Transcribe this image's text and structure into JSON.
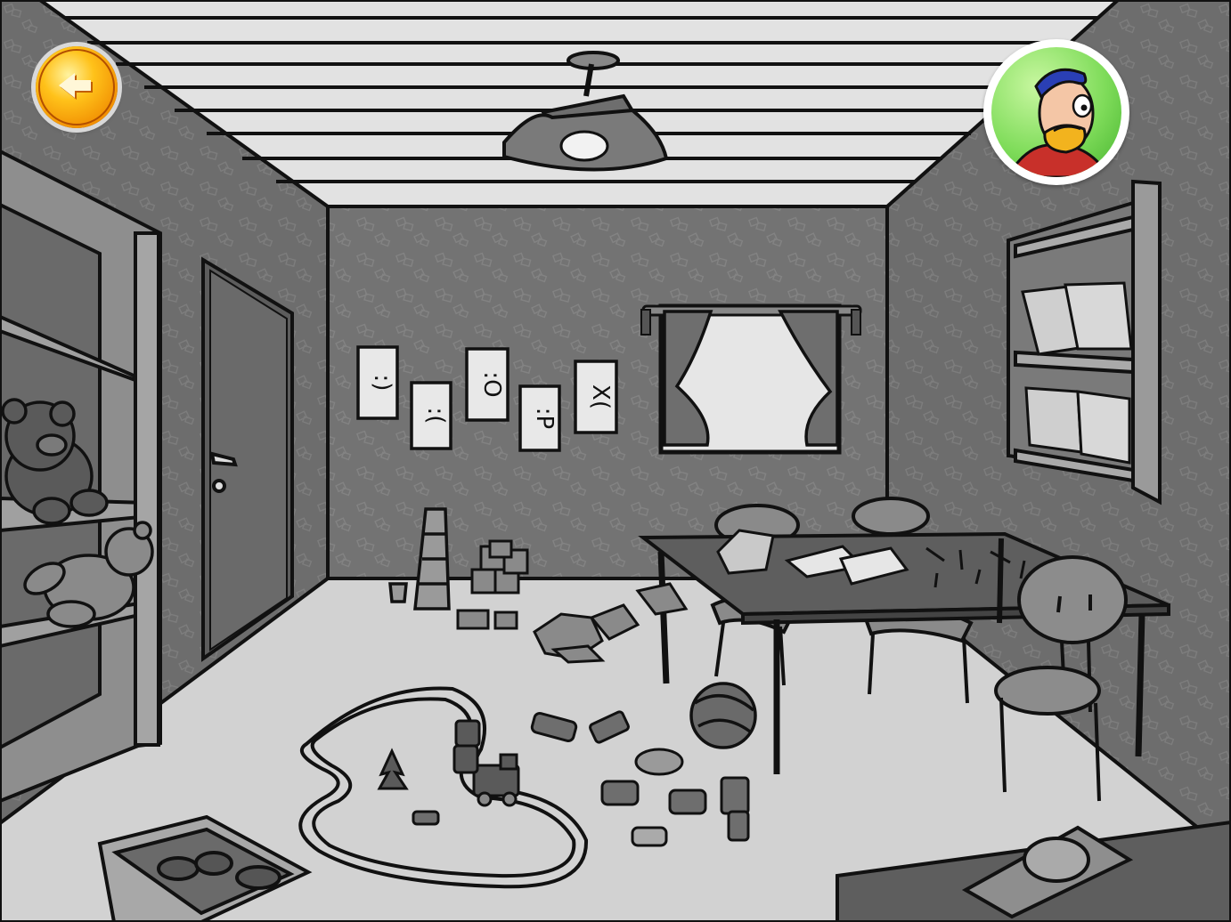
{
  "scene": {
    "name": "playroom",
    "style": "grayscale hand-drawn"
  },
  "ui": {
    "back_button": {
      "icon": "arrow-left-icon",
      "color": "#f7a20e"
    },
    "character_button": {
      "icon": "character-avatar-icon",
      "color": "#6fd34d"
    }
  },
  "posters": [
    {
      "face": ":)"
    },
    {
      "face": ":("
    },
    {
      "face": ":O"
    },
    {
      "face": ":P"
    },
    {
      "face": "X("
    }
  ]
}
